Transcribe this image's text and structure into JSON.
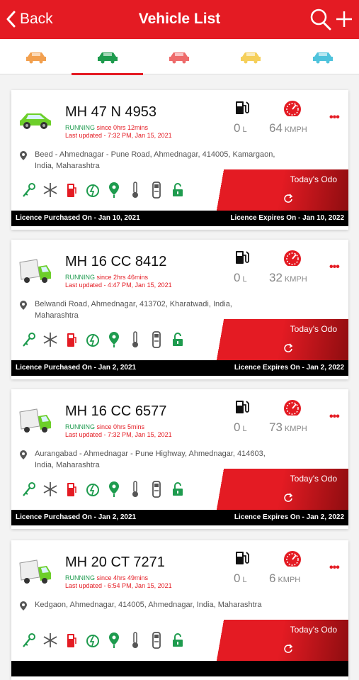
{
  "header": {
    "back_label": "Back",
    "title": "Vehicle List"
  },
  "tabs": [
    {
      "icon": "car-icon",
      "color": "#f2a04f"
    },
    {
      "icon": "car-icon",
      "color": "#1e9b4e"
    },
    {
      "icon": "car-icon",
      "color": "#ee6b6b"
    },
    {
      "icon": "car-icon",
      "color": "#f5cf5a"
    },
    {
      "icon": "car-icon",
      "color": "#4fc3dc"
    }
  ],
  "vehicles": [
    {
      "type": "car",
      "plate": "MH 47 N 4953",
      "status": "RUNNING",
      "since": " since 0hrs 12mins",
      "last_updated": "Last updated - 7:32 PM, Jan 15, 2021",
      "fuel": "0",
      "fuel_unit": "L",
      "speed": "64",
      "speed_unit": "KMPH",
      "address": "Beed - Ahmednagar - Pune Road, Ahmednagar, 414005, Kamargaon, India, Maharashtra",
      "odo_label": "Today's Odo",
      "licence_purchased": "Licence Purchased On - Jan 10, 2021",
      "licence_expires": "Licence Expires On - Jan 10, 2022"
    },
    {
      "type": "truck",
      "plate": "MH 16 CC 8412",
      "status": "RUNNING",
      "since": " since 2hrs 46mins",
      "last_updated": "Last updated - 4:47 PM, Jan 15, 2021",
      "fuel": "0",
      "fuel_unit": "L",
      "speed": "32",
      "speed_unit": "KMPH",
      "address": "Belwandi Road, Ahmednagar, 413702, Kharatwadi, India, Maharashtra",
      "odo_label": "Today's Odo",
      "licence_purchased": "Licence Purchased On - Jan 2, 2021",
      "licence_expires": "Licence Expires On - Jan 2, 2022"
    },
    {
      "type": "truck",
      "plate": "MH 16 CC 6577",
      "status": "RUNNING",
      "since": " since 0hrs 5mins",
      "last_updated": "Last updated - 7:32 PM, Jan 15, 2021",
      "fuel": "0",
      "fuel_unit": "L",
      "speed": "73",
      "speed_unit": "KMPH",
      "address": "Aurangabad - Ahmednagar - Pune Highway, Ahmednagar, 414603, India, Maharashtra",
      "odo_label": "Today's Odo",
      "licence_purchased": "Licence Purchased On - Jan 2, 2021",
      "licence_expires": "Licence Expires On - Jan 2, 2022"
    },
    {
      "type": "truck",
      "plate": "MH 20 CT 7271",
      "status": "RUNNING",
      "since": " since 4hrs 49mins",
      "last_updated": "Last updated - 6:54 PM, Jan 15, 2021",
      "fuel": "0",
      "fuel_unit": "L",
      "speed": "6",
      "speed_unit": "KMPH",
      "address": "Kedgaon, Ahmednagar, 414005, Ahmednagar, India, Maharashtra",
      "odo_label": "Today's Odo",
      "licence_purchased": "",
      "licence_expires": ""
    }
  ],
  "status_icons": [
    "key-icon",
    "ac-snowflake-icon",
    "fuel-icon",
    "power-icon",
    "gps-pin-icon",
    "temperature-icon",
    "door-icon",
    "lock-icon"
  ],
  "colors": {
    "brand": "#e41b23",
    "running": "#1e9b4e",
    "icon_green": "#1e9b4e"
  }
}
